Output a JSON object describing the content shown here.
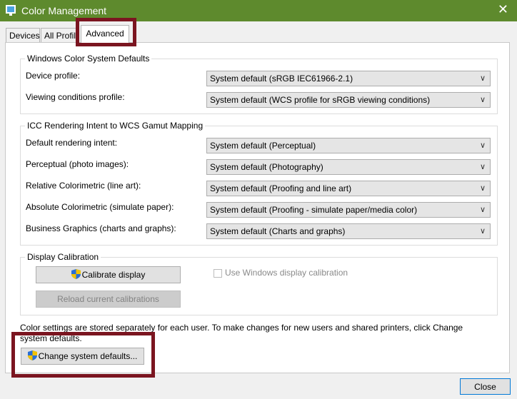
{
  "window": {
    "title": "Color Management",
    "close_glyph": "✕"
  },
  "tabs": [
    "Devices",
    "All Profile",
    "Advanced"
  ],
  "wcs_defaults": {
    "title": "Windows Color System Defaults",
    "rows": [
      {
        "label": "Device profile:",
        "value": "System default (sRGB IEC61966-2.1)"
      },
      {
        "label": "Viewing conditions profile:",
        "value": "System default (WCS profile for sRGB viewing conditions)"
      }
    ]
  },
  "icc_mapping": {
    "title": "ICC Rendering Intent to WCS Gamut Mapping",
    "rows": [
      {
        "label": "Default rendering intent:",
        "value": "System default (Perceptual)"
      },
      {
        "label": "Perceptual (photo images):",
        "value": "System default (Photography)"
      },
      {
        "label": "Relative Colorimetric (line art):",
        "value": "System default (Proofing and line art)"
      },
      {
        "label": "Absolute Colorimetric (simulate paper):",
        "value": "System default (Proofing - simulate paper/media color)"
      },
      {
        "label": "Business Graphics (charts and graphs):",
        "value": "System default (Charts and graphs)"
      }
    ]
  },
  "calibration": {
    "title": "Display Calibration",
    "calibrate_label": "Calibrate display",
    "reload_label": "Reload current calibrations",
    "use_windows_label": "Use Windows display calibration"
  },
  "footer": {
    "note": "Color settings are stored separately for each user. To make changes for new users and shared printers, click Change system defaults.",
    "change_defaults_label": "Change system defaults...",
    "close_label": "Close"
  },
  "icons": {
    "dropdown": "chevron-down-icon",
    "shield": "uac-shield-icon"
  },
  "colors": {
    "titlebar": "#5e8a2d",
    "highlight": "#7b1520"
  }
}
